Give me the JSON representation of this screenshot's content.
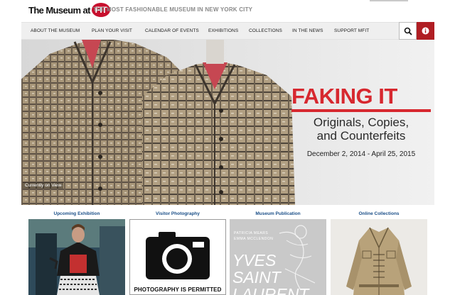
{
  "header": {
    "logo_text": "The Museum at",
    "logo_badge": "FIT",
    "tagline": "THE MOST FASHIONABLE MUSEUM IN NEW YORK CITY"
  },
  "nav": {
    "items": [
      {
        "label": "ABOUT THE MUSEUM"
      },
      {
        "label": "PLAN YOUR VISIT"
      },
      {
        "label": "CALENDAR OF EVENTS"
      },
      {
        "label": "EXHIBITIONS"
      },
      {
        "label": "COLLECTIONS"
      },
      {
        "label": "IN THE NEWS"
      },
      {
        "label": "SUPPORT MFIT"
      }
    ],
    "search_icon": "search-icon",
    "info_icon": "info-icon"
  },
  "hero": {
    "title": "FAKING IT",
    "subtitle_line1": "Originals, Copies,",
    "subtitle_line2": "and Counterfeits",
    "dates": "December 2, 2014 - April 25, 2015",
    "badge": "Currently on View",
    "accent_color": "#d7282f"
  },
  "features": [
    {
      "label": "Upcoming Exhibition"
    },
    {
      "label": "Visitor Photography",
      "caption": "PHOTOGRAPHY IS PERMITTED"
    },
    {
      "label": "Museum Publication",
      "book_author_1": "PATRICIA MEARS",
      "book_author_2": "EMMA MCCLENDON",
      "book_title_1": "YVES",
      "book_title_2": "SAINT",
      "book_title_3": "LAURENT"
    },
    {
      "label": "Online Collections"
    }
  ]
}
